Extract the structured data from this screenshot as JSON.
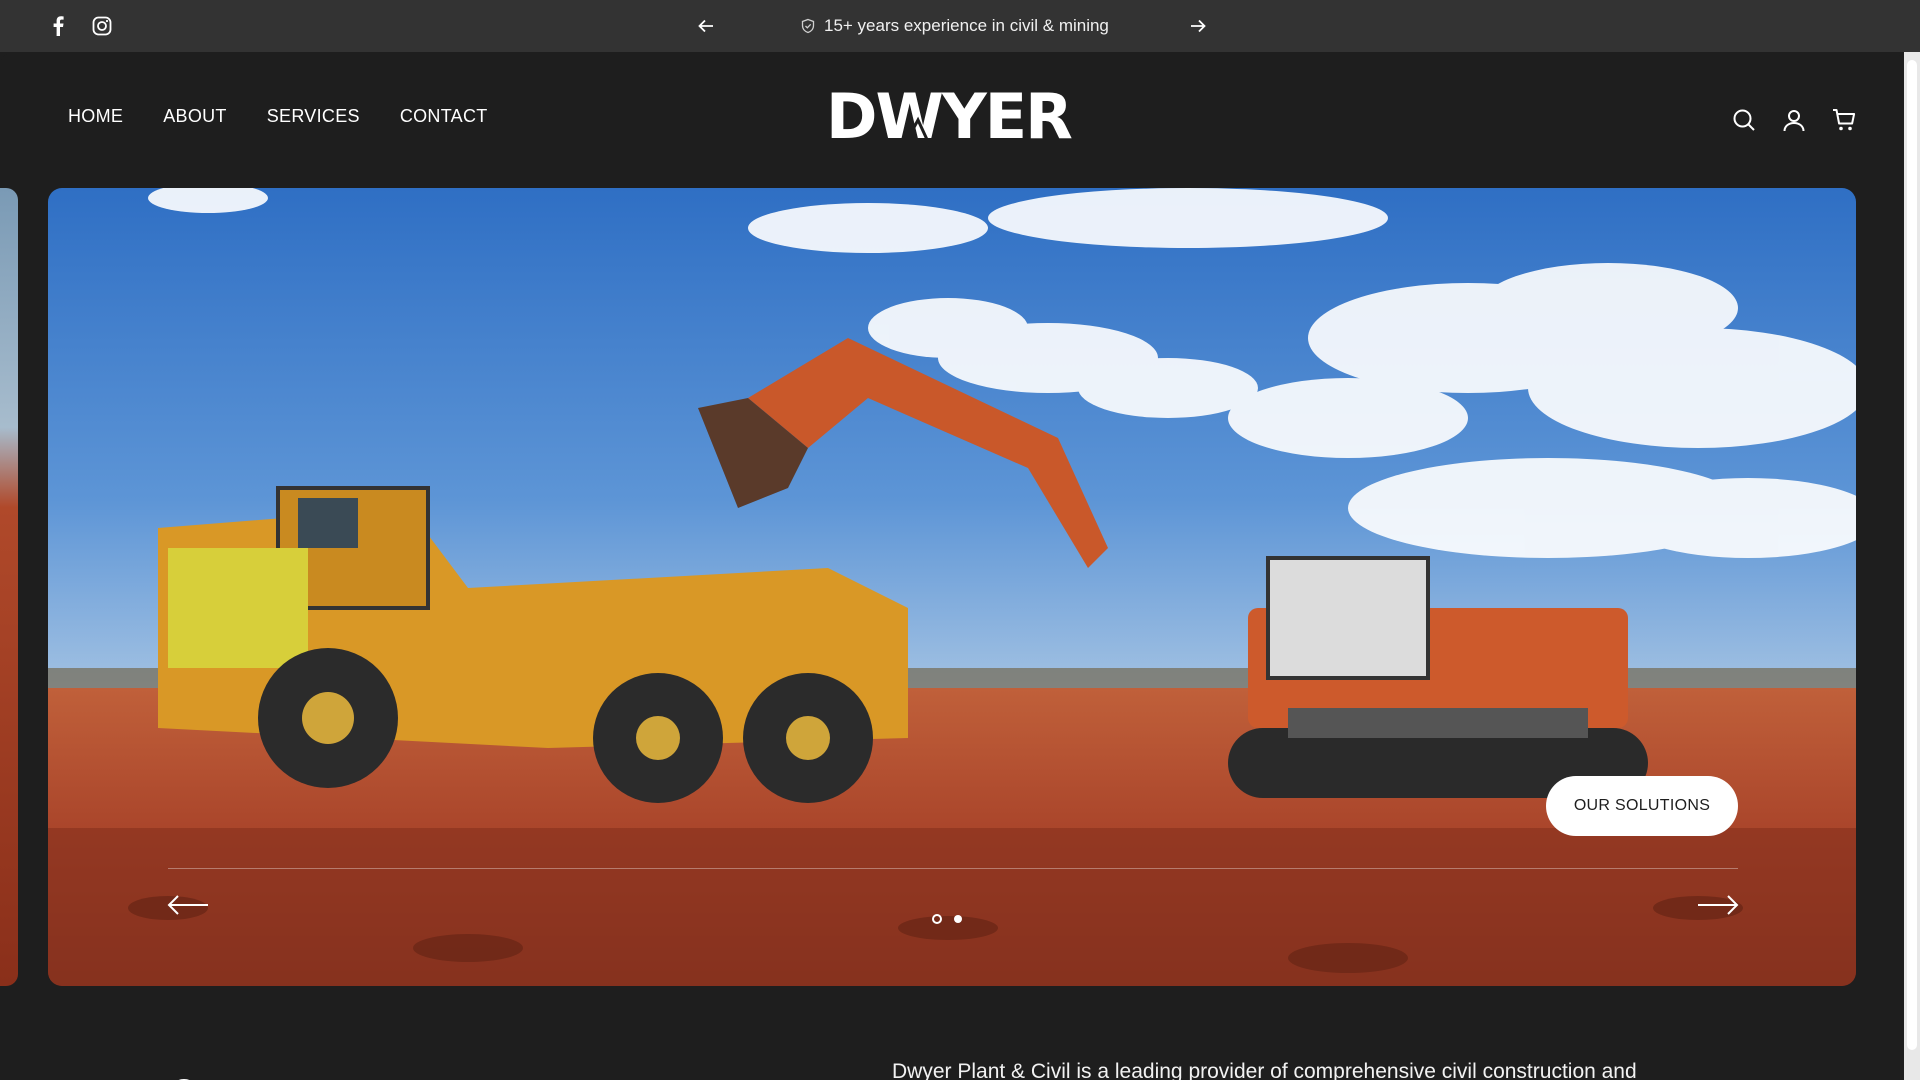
{
  "announcement": {
    "text": "15+ years experience in civil & mining",
    "prev_icon": "arrow-left-icon",
    "next_icon": "arrow-right-icon",
    "badge_icon": "shield-check-icon"
  },
  "social": [
    {
      "name": "facebook-icon"
    },
    {
      "name": "instagram-icon"
    }
  ],
  "nav": {
    "items": [
      "HOME",
      "ABOUT",
      "SERVICES",
      "CONTACT"
    ]
  },
  "logo": {
    "text": "DWYER"
  },
  "header_icons": [
    "search-icon",
    "account-icon",
    "cart-icon"
  ],
  "hero": {
    "button_label": "OUR SOLUTIONS",
    "slide_count": 2,
    "active_slide": 1
  },
  "intro": {
    "text": "Dwyer Plant & Civil is a leading provider of comprehensive civil construction and"
  },
  "colors": {
    "bar": "#333333",
    "background": "#1e1e1e",
    "sky": "#3d7cc9",
    "earth": "#b0472a"
  }
}
